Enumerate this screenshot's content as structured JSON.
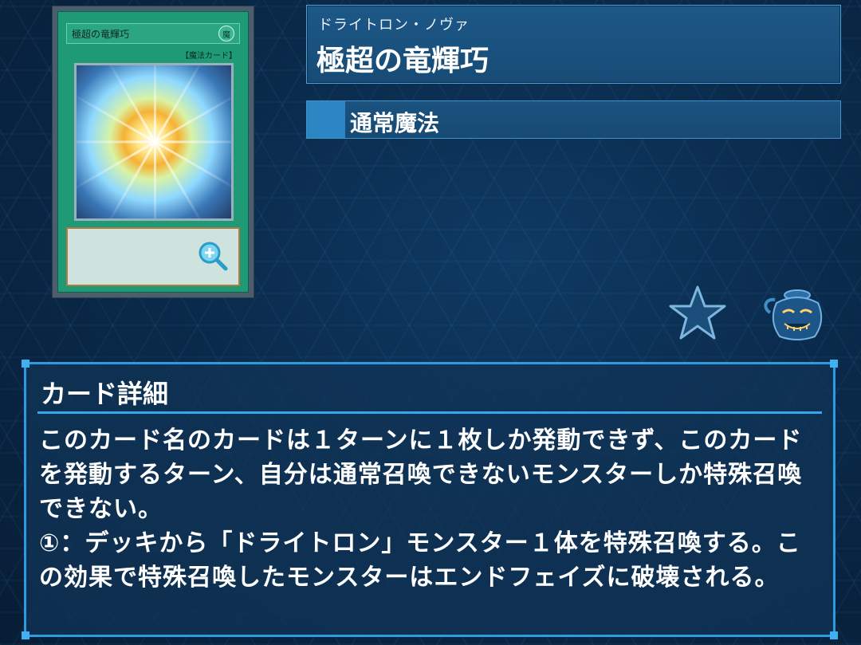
{
  "card": {
    "ruby": "ドライトロン・ノヴァ",
    "name": "極超の竜輝巧",
    "type_label": "通常魔法",
    "image": {
      "name_text": "極超の竜輝巧",
      "attribute_glyph": "魔",
      "type_text": "【魔法カード】"
    }
  },
  "detail": {
    "title": "カード詳細",
    "text": "このカード名のカードは１ターンに１枚しか発動できず、このカードを発動するターン、自分は通常召喚できないモンスターしか特殊召喚できない。\n①：デッキから「ドライトロン」モンスター１体を特殊召喚する。この効果で特殊召喚したモンスターはエンドフェイズに破壊される。"
  },
  "icons": {
    "favorite": "star-icon",
    "zoom": "zoom-in-icon",
    "deck_pot": "pot-of-greed-icon"
  },
  "colors": {
    "accent": "#2e9be0",
    "spell_card_green": "#1f9a77",
    "panel": "#174b76"
  }
}
